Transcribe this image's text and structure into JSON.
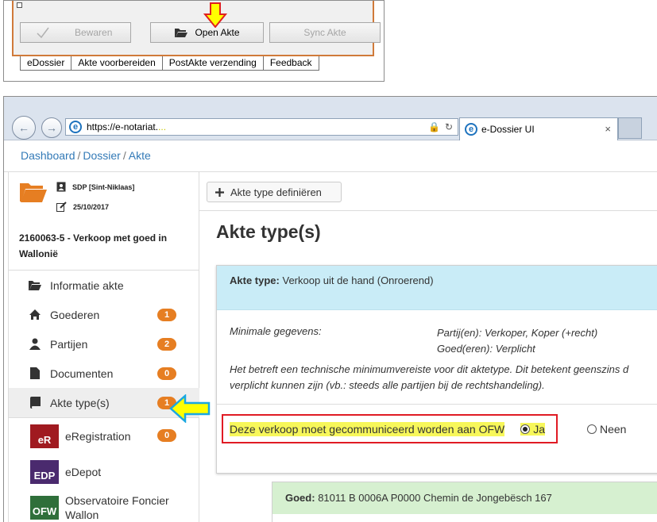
{
  "app": {
    "buttons": {
      "bewaren": "Bewaren",
      "open_akte": "Open Akte",
      "sync_akte": "Sync Akte"
    },
    "tabs": [
      "eDossier",
      "Akte voorbereiden",
      "PostAkte verzending",
      "Feedback"
    ]
  },
  "browser": {
    "url": "https://e-notariat.",
    "url_trail": "...",
    "tab_title": "e-Dossier UI",
    "tab_close": "×"
  },
  "breadcrumb": {
    "items": [
      "Dashboard",
      "Dossier",
      "Akte"
    ],
    "separator": "/"
  },
  "dossier": {
    "office": "SDP [Sint-Niklaas]",
    "date": "25/10/2017",
    "title": "2160063-5 - Verkoop met goed in Wallonië"
  },
  "menu": {
    "items": [
      {
        "label": "Informatie akte",
        "icon": "folder-open-icon",
        "badge": null
      },
      {
        "label": "Goederen",
        "icon": "home-icon",
        "badge": "1"
      },
      {
        "label": "Partijen",
        "icon": "user-icon",
        "badge": "2"
      },
      {
        "label": "Documenten",
        "icon": "file-icon",
        "badge": "0"
      },
      {
        "label": "Akte type(s)",
        "icon": "book-icon",
        "badge": "1"
      }
    ],
    "external": [
      {
        "label": "eRegistration",
        "logo": "eR",
        "badge": "0"
      },
      {
        "label": "eDepot",
        "logo": "EDP"
      },
      {
        "label": "Observatoire Foncier Wallon",
        "logo": "OFW"
      }
    ]
  },
  "main": {
    "toolbar_button": "Akte type definiëren",
    "page_title": "Akte type(s)",
    "akte_panel": {
      "heading_label": "Akte type:",
      "heading_value": "Verkoop uit de hand (Onroerend)",
      "minimal_label": "Minimale gegevens:",
      "minimal_values": [
        "Partij(en): Verkoper, Koper (+recht)",
        "Goed(eren): Verplicht"
      ],
      "description_lines": [
        "Het betreft een technische minimumvereiste voor dit aktetype. Dit betekent geenszins d",
        "verplicht kunnen zijn (vb.: steeds alle partijen bij de rechtshandeling)."
      ],
      "question": "Deze verkoop moet gecommuniceerd worden aan OFW",
      "option_yes": "Ja",
      "option_no": "Neen",
      "selected": "Ja"
    },
    "goed_panel": {
      "heading_label": "Goed:",
      "heading_value": "81011 B 0006A P0000 Chemin de Jongebësch 167"
    }
  },
  "colors": {
    "badge": "#e67e22",
    "link": "#337ab7",
    "akte_heading_bg": "#c9ecf7",
    "goed_heading_bg": "#d6f0d0",
    "highlight": "#f7f75a",
    "focus_border": "#e01b24"
  }
}
